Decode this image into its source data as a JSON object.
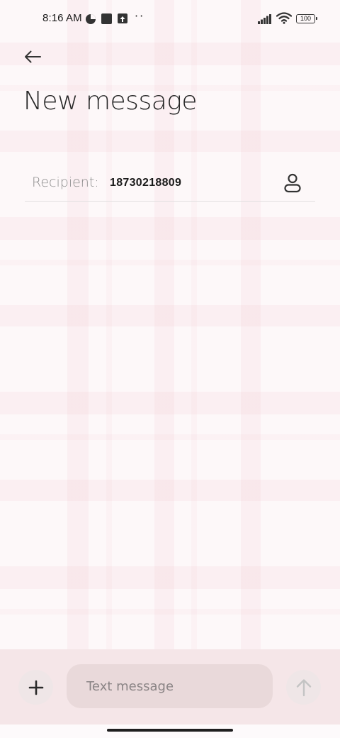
{
  "status_bar": {
    "time": "8:16 AM",
    "battery": "100",
    "more": "··"
  },
  "header": {
    "title": "New message"
  },
  "recipient": {
    "label": "Recipient:",
    "value": "18730218809"
  },
  "compose": {
    "placeholder": "Text message"
  },
  "icons": {
    "back": "arrow-left-icon",
    "contact": "person-icon",
    "add": "plus-icon",
    "send": "arrow-up-icon"
  },
  "colors": {
    "compose_bar_bg": "#f5e6e8",
    "input_bg": "#e9d9da",
    "send_disabled": "#c4c4c4"
  }
}
